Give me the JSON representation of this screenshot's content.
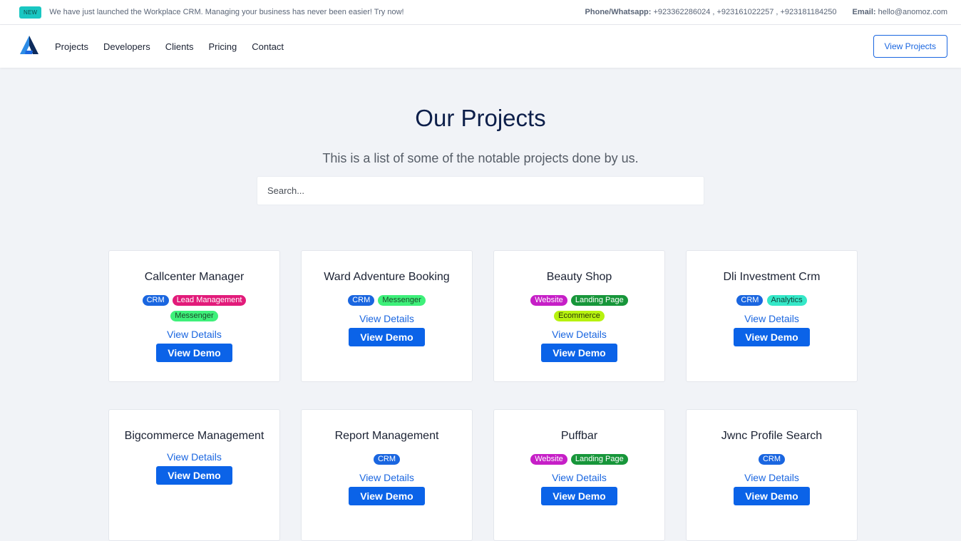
{
  "topbar": {
    "badge": "NEW",
    "announcement": "We have just launched the Workplace CRM. Managing your business has never been easier! Try now!",
    "phone_label": "Phone/Whatsapp:",
    "phone_numbers": "+923362286024 , +923161022257 , +923181184250",
    "email_label": "Email:",
    "email": "hello@anomoz.com"
  },
  "nav": {
    "logo_icon": "anomoz-logo",
    "items": [
      "Projects",
      "Developers",
      "Clients",
      "Pricing",
      "Contact"
    ],
    "cta": "View Projects"
  },
  "hero": {
    "title": "Our Projects",
    "subtitle": "This is a list of some of the notable projects done by us.",
    "search_placeholder": "Search..."
  },
  "card_actions": {
    "details": "View Details",
    "demo": "View Demo"
  },
  "projects": [
    {
      "title": "Callcenter Manager",
      "tags": [
        "CRM",
        "Lead Management",
        "Messenger"
      ]
    },
    {
      "title": "Ward Adventure Booking",
      "tags": [
        "CRM",
        "Messenger"
      ]
    },
    {
      "title": "Beauty Shop",
      "tags": [
        "Website",
        "Landing Page",
        "Ecommerce"
      ]
    },
    {
      "title": "Dli Investment Crm",
      "tags": [
        "CRM",
        "Analytics"
      ]
    },
    {
      "title": "Bigcommerce Management",
      "tags": []
    },
    {
      "title": "Report Management",
      "tags": [
        "CRM"
      ]
    },
    {
      "title": "Puffbar",
      "tags": [
        "Website",
        "Landing Page"
      ]
    },
    {
      "title": "Jwnc Profile Search",
      "tags": [
        "CRM"
      ]
    }
  ],
  "colors": {
    "accent": "#1a66e0",
    "heading": "#0d1f4a",
    "new_badge": "#19c7c2",
    "tag_crm": "#1a66e0",
    "tag_lead_management": "#e21b7a",
    "tag_messenger": "#3ef07a",
    "tag_website": "#c61fc7",
    "tag_landing_page": "#17963a",
    "tag_ecommerce": "#b7f20f",
    "tag_analytics": "#35e8c8"
  }
}
